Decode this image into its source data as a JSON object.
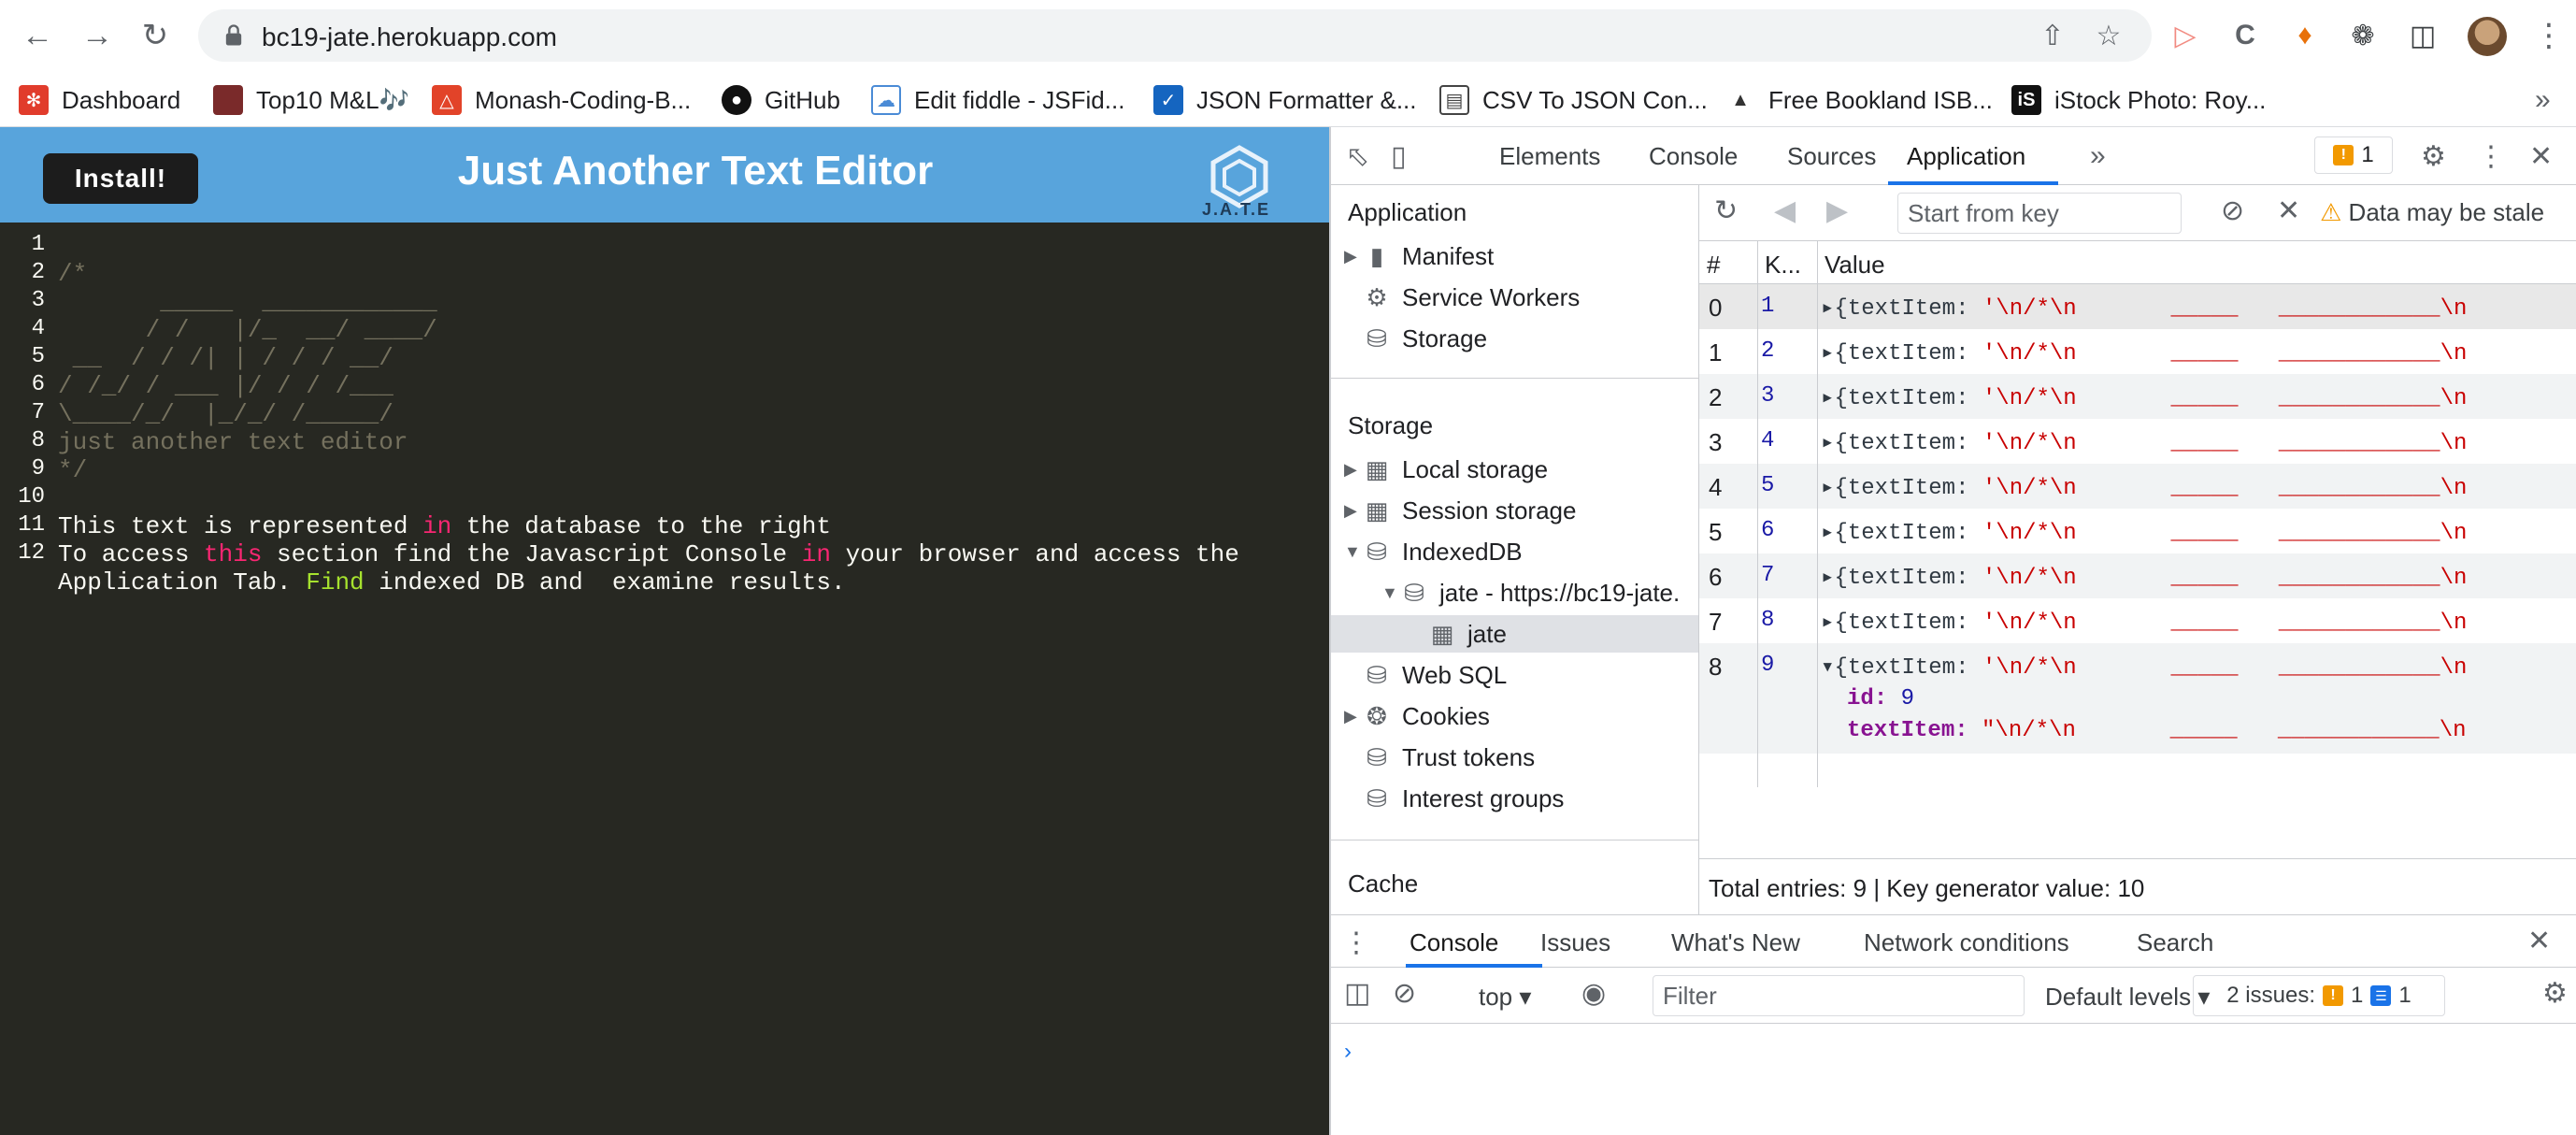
{
  "browser": {
    "url": "bc19-jate.herokuapp.com",
    "bookmarks": [
      {
        "label": "Dashboard",
        "icon": "canvas-icon",
        "color": "#e13c2c"
      },
      {
        "label": "Top10 M&L🎶",
        "icon": "album-icon",
        "color": "#7a2a2a"
      },
      {
        "label": "Monash-Coding-B...",
        "icon": "gitlab-icon",
        "color": "#e24329"
      },
      {
        "label": "GitHub",
        "icon": "github-icon",
        "color": "#111111"
      },
      {
        "label": "Edit fiddle - JSFid...",
        "icon": "cloud-icon",
        "color": "#4a8bd6"
      },
      {
        "label": "JSON Formatter &...",
        "icon": "checkbox-icon",
        "color": "#1565c0"
      },
      {
        "label": "CSV To JSON Con...",
        "icon": "document-icon",
        "color": "#444444"
      },
      {
        "label": "Free Bookland ISB...",
        "icon": "linux-icon",
        "color": "#333333"
      },
      {
        "label": "iStock Photo: Roy...",
        "icon": "istock-icon",
        "color": "#111111"
      }
    ]
  },
  "app": {
    "install_label": "Install!",
    "title": "Just Another Text Editor",
    "logo_text": "J.A.T.E",
    "lines": [
      "1",
      "2",
      "3",
      "4",
      "5",
      "6",
      "7",
      "8",
      "9",
      "10",
      "11",
      "12"
    ]
  },
  "devtools": {
    "tabs": [
      "Elements",
      "Console",
      "Sources",
      "Application"
    ],
    "active_tab": "Application",
    "issues_count": "1",
    "sidebar": {
      "application_heading": "Application",
      "app_items": [
        "Manifest",
        "Service Workers",
        "Storage"
      ],
      "storage_heading": "Storage",
      "storage_items": [
        "Local storage",
        "Session storage",
        "IndexedDB",
        "jate - https://bc19-jate.",
        "jate",
        "Web SQL",
        "Cookies",
        "Trust tokens",
        "Interest groups"
      ],
      "cache_heading": "Cache"
    },
    "toolbar": {
      "key_placeholder": "Start from key",
      "stale_text": "Data may be stale"
    },
    "table": {
      "headers": [
        "#",
        "K...",
        "Value"
      ],
      "rows": [
        {
          "idx": "0",
          "key": "1"
        },
        {
          "idx": "1",
          "key": "2"
        },
        {
          "idx": "2",
          "key": "3"
        },
        {
          "idx": "3",
          "key": "4"
        },
        {
          "idx": "4",
          "key": "5"
        },
        {
          "idx": "5",
          "key": "6"
        },
        {
          "idx": "6",
          "key": "7"
        },
        {
          "idx": "7",
          "key": "8"
        },
        {
          "idx": "8",
          "key": "9"
        }
      ],
      "value_prefix": "{textItem: ",
      "value_str": "'\\n/*\\n       _____   ____________\\n",
      "expanded_id_label": "id",
      "expanded_id_value": "9",
      "expanded_text_label": "textItem",
      "expanded_text_value": "\"\\n/*\\n       _____   ____________\\n"
    },
    "footer_text": "Total entries: 9 | Key generator value: 10",
    "drawer": {
      "tabs": [
        "Console",
        "Issues",
        "What's New",
        "Network conditions",
        "Search"
      ],
      "context": "top",
      "filter_placeholder": "Filter",
      "levels": "Default levels",
      "issues_label": "2 issues:",
      "warn_count": "1",
      "info_count": "1"
    }
  }
}
